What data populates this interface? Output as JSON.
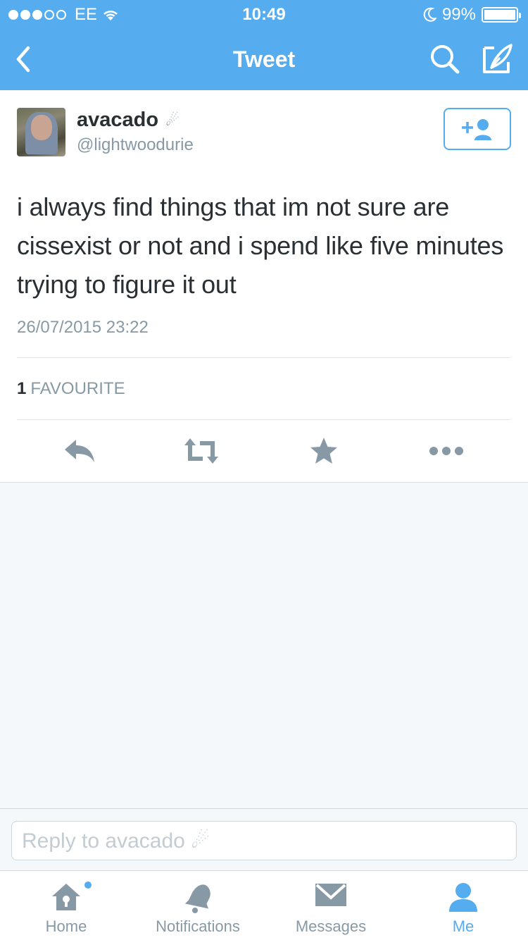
{
  "status_bar": {
    "carrier": "EE",
    "time": "10:49",
    "battery_percent": "99%",
    "battery_level": 0.99,
    "signal_bars_filled": 3,
    "signal_bars_total": 5
  },
  "nav": {
    "title": "Tweet",
    "back_icon": "chevron-left-icon",
    "search_icon": "search-icon",
    "compose_icon": "compose-icon"
  },
  "tweet": {
    "display_name": "avacado",
    "name_emoji": "☄",
    "handle": "@lightwoodurie",
    "text": "i always find things that im not sure are cissexist or not and i spend like five minutes trying to figure it out",
    "timestamp": "26/07/2015 23:22",
    "favourite_count": "1",
    "favourite_label": "FAVOURITE",
    "follow_icon": "add-user-icon"
  },
  "actions": [
    "reply-icon",
    "retweet-icon",
    "favorite-icon",
    "more-icon"
  ],
  "reply": {
    "placeholder": "Reply to avacado ☄"
  },
  "tabs": [
    {
      "label": "Home",
      "icon": "home-icon",
      "active": false
    },
    {
      "label": "Notifications",
      "icon": "bell-icon",
      "active": false
    },
    {
      "label": "Messages",
      "icon": "envelope-icon",
      "active": false
    },
    {
      "label": "Me",
      "icon": "person-icon",
      "active": true
    }
  ],
  "colors": {
    "brand": "#55acee",
    "icon_gray": "#8899a6",
    "text": "#292f33",
    "background": "#f5f8fa"
  }
}
